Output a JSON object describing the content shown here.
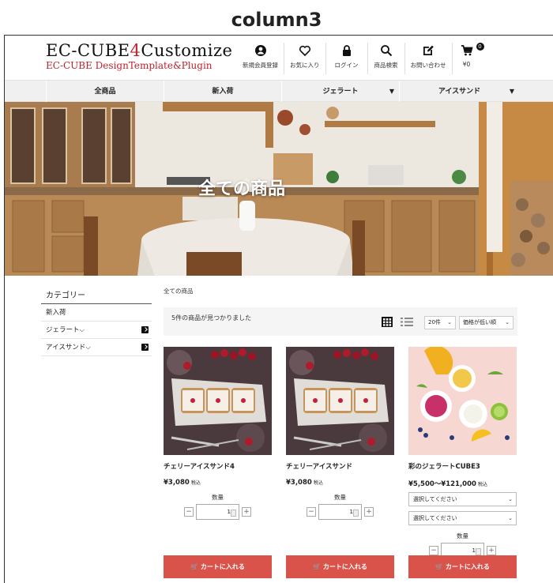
{
  "caption": "column3",
  "logo": {
    "line1_a": "EC-CUBE",
    "line1_b": "4",
    "line1_c": "Customize",
    "line2": "EC-CUBE DesignTemplate&Plugin"
  },
  "header_nav": [
    {
      "label": "新規会員登録",
      "icon": "user-icon"
    },
    {
      "label": "お気に入り",
      "icon": "heart-icon"
    },
    {
      "label": "ログイン",
      "icon": "lock-icon"
    },
    {
      "label": "商品検索",
      "icon": "search-icon"
    },
    {
      "label": "お問い合わせ",
      "icon": "edit-icon"
    }
  ],
  "cart": {
    "badge": "0",
    "total": "¥0"
  },
  "category_bar": [
    {
      "label": "全商品"
    },
    {
      "label": "新入荷"
    },
    {
      "label": "ジェラート",
      "arrow": "▼"
    },
    {
      "label": "アイスサンド",
      "arrow": "▼"
    }
  ],
  "hero": {
    "title": "全ての商品"
  },
  "sidebar": {
    "heading": "カテゴリー",
    "items": [
      {
        "label": "新入荷"
      },
      {
        "label": "ジェラート⌵"
      },
      {
        "label": "アイスサンド⌵"
      }
    ]
  },
  "breadcrumb": "全ての商品",
  "results": {
    "text": "5件の商品が見つかりました",
    "per_page": "20件",
    "sort": "価格が低い順"
  },
  "products": [
    {
      "name": "チェリーアイスサンド4",
      "price": "¥3,080",
      "tax": "税込",
      "qty_label": "数量",
      "qty": "1",
      "cart_label": "カートに入れる"
    },
    {
      "name": "チェリーアイスサンド",
      "price": "¥3,080",
      "tax": "税込",
      "qty_label": "数量",
      "qty": "1",
      "cart_label": "カートに入れる"
    },
    {
      "name": "彩のジェラートCUBE3",
      "price": "¥5,500～¥121,000",
      "tax": "税込",
      "options": [
        "選択してください",
        "選択してください"
      ],
      "qty_label": "数量",
      "qty": "1",
      "cart_label": "カートに入れる"
    }
  ],
  "colors": {
    "accent": "#d9534a",
    "logo_red": "#c0222b"
  }
}
